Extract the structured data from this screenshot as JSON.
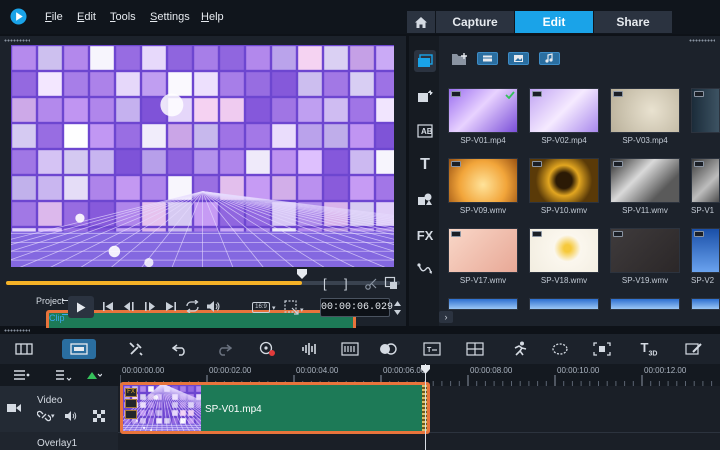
{
  "menu": {
    "items": [
      {
        "label": "File",
        "underline": "F",
        "rest": "ile"
      },
      {
        "label": "Edit",
        "underline": "E",
        "rest": "dit"
      },
      {
        "label": "Tools",
        "underline": "T",
        "rest": "ools"
      },
      {
        "label": "Settings",
        "underline": "S",
        "rest": "ettings"
      },
      {
        "label": "Help",
        "underline": "H",
        "rest": "elp"
      }
    ]
  },
  "workspace_tabs": {
    "capture": "Capture",
    "edit": "Edit",
    "share": "Share",
    "active": "Edit"
  },
  "player": {
    "project_label": "Project",
    "clip_label": "Clip",
    "timecode": "00:00:06.029",
    "aspect_label": "16:9",
    "position_fraction": 0.75,
    "accent_color": "#f5b227"
  },
  "library": {
    "thumbnails": [
      {
        "name": "SP-V01.mp4",
        "style": "disco-purple",
        "used": true
      },
      {
        "name": "SP-V02.mp4",
        "style": "disco-purple-light",
        "used": false
      },
      {
        "name": "SP-V03.mp4",
        "style": "beige",
        "used": false
      },
      {
        "name": "",
        "style": "dark-edge",
        "used": false
      },
      {
        "name": "SP-V09.wmv",
        "style": "orange-glow",
        "used": false
      },
      {
        "name": "SP-V10.wmv",
        "style": "gold-frame",
        "used": false
      },
      {
        "name": "SP-V11.wmv",
        "style": "photo-frame",
        "used": false
      },
      {
        "name": "SP-V1",
        "style": "dark-frame",
        "used": false
      },
      {
        "name": "SP-V17.wmv",
        "style": "peach",
        "used": false
      },
      {
        "name": "SP-V18.wmv",
        "style": "white-floral",
        "used": false
      },
      {
        "name": "SP-V19.wmv",
        "style": "dark-texture",
        "used": false
      },
      {
        "name": "SP-V2",
        "style": "blue",
        "used": false
      }
    ]
  },
  "timeline": {
    "ruler_labels": [
      "00:00:00.00",
      "00:00:02.00",
      "00:00:04.00",
      "00:00:06.00",
      "00:00:08.00",
      "00:00:10.00",
      "00:00:12.00"
    ],
    "tracks": [
      {
        "name": "Video"
      },
      {
        "name": "Overlay1"
      }
    ],
    "clip": {
      "name": "SP-V01.mp4",
      "fx_label": "FX",
      "color": "#1d7a57",
      "border_color": "#e8743c"
    }
  }
}
